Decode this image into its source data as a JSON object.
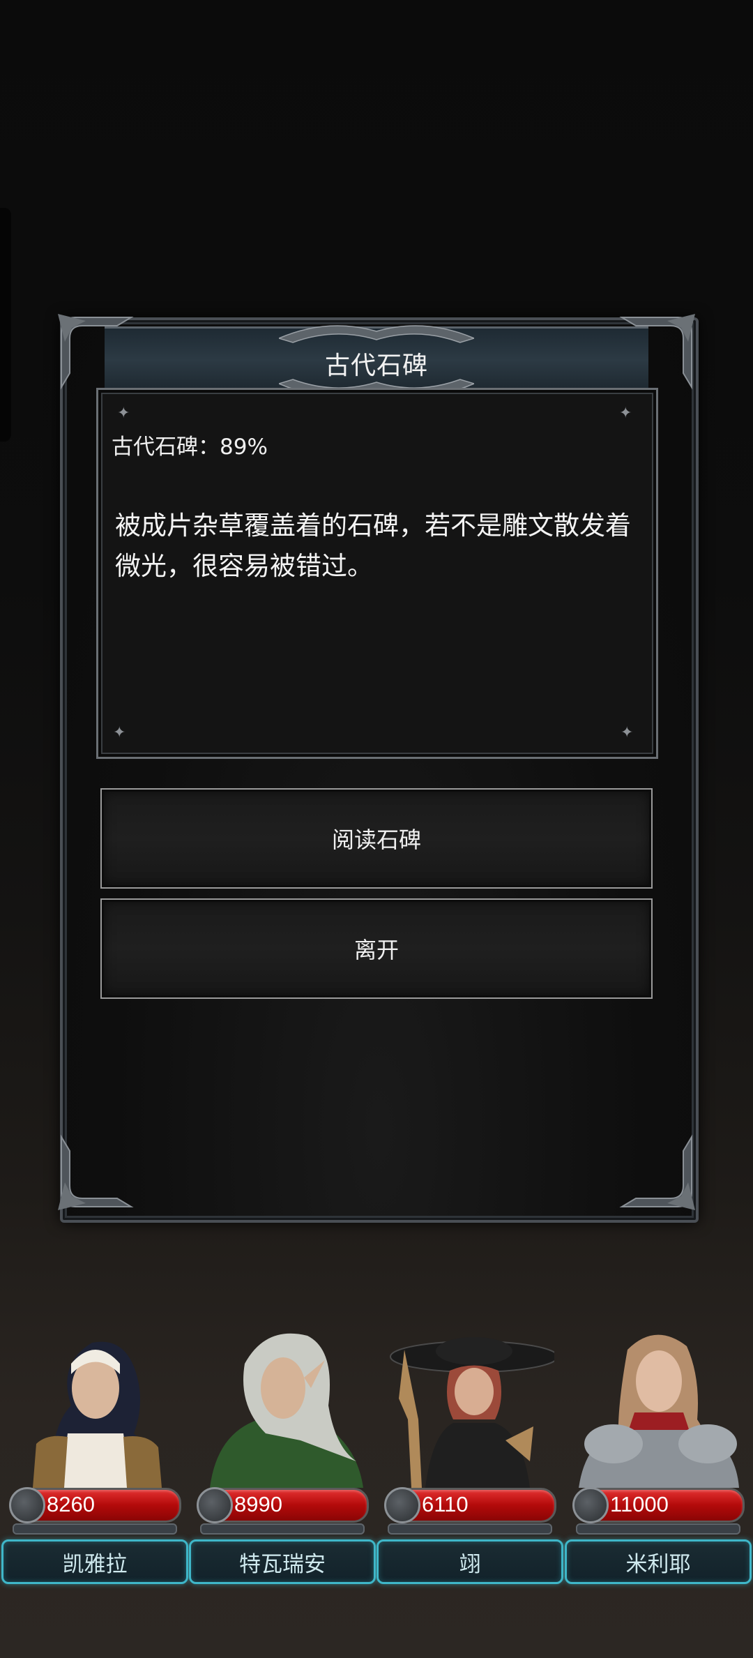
{
  "event": {
    "title": "古代石碑",
    "status": "古代石碑：89%",
    "description": "被成片杂草覆盖着的石碑，若不是雕文散发着微光，很容易被错过。",
    "choices": [
      "阅读石碑",
      "离开"
    ]
  },
  "party": [
    {
      "name": "凯雅拉",
      "hp": "8260"
    },
    {
      "name": "特瓦瑞安",
      "hp": "8990"
    },
    {
      "name": "翊",
      "hp": "6110"
    },
    {
      "name": "米利耶",
      "hp": "11000"
    }
  ],
  "colors": {
    "hp_bar": "#c01010",
    "name_plate_border": "#3fb7c9",
    "title_bar": "#2c3a44"
  }
}
